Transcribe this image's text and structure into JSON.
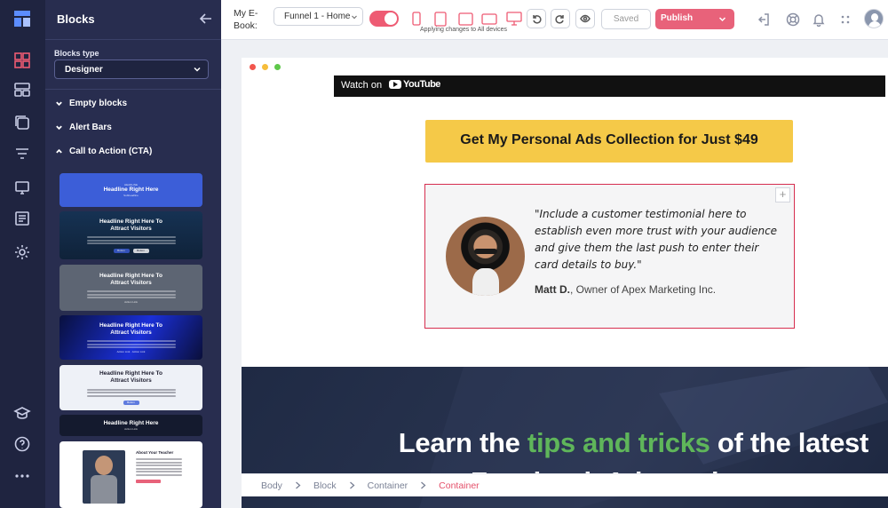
{
  "panel": {
    "title": "Blocks",
    "blocks_type_label": "Blocks type",
    "blocks_type_value": "Designer",
    "categories": [
      {
        "label": "Empty blocks",
        "state": "collapsed"
      },
      {
        "label": "Alert Bars",
        "state": "collapsed"
      },
      {
        "label": "Call to Action (CTA)",
        "state": "expanded"
      }
    ],
    "thumbnails": [
      {
        "kicker": "HEADLINE",
        "headline": "Headline Right Here",
        "sub": "Subheadline"
      },
      {
        "headline": "Headline Right Here To Attract Visitors",
        "buttons": [
          "Button",
          "Button"
        ]
      },
      {
        "headline": "Headline Right Here To Attract Visitors",
        "sub": "Action Link"
      },
      {
        "headline": "Headline Right Here To Attract Visitors",
        "sub": "Action Link · Action Link"
      },
      {
        "headline": "Headline Right Here To Attract Visitors",
        "buttons": [
          "Button"
        ]
      },
      {
        "headline": "Headline Right Here",
        "sub": "Action Link"
      },
      {
        "headline": "About Your Teacher"
      }
    ]
  },
  "toolbar": {
    "ebook_label": "My E-Book:",
    "funnel_select": "Funnel 1 - Home",
    "applying_text": "Applying changes to All devices",
    "saved_label": "Saved",
    "publish_label": "Publish",
    "accent": "#ee5b73"
  },
  "canvas": {
    "video": {
      "watch_label": "Watch on",
      "brand": "YouTube"
    },
    "cta_button": "Get My Personal Ads Collection for Just $49",
    "testimonial": {
      "quote": "\"Include a customer testimonial here to establish even more trust with your audience and give them the last push to enter their card details to buy.\"",
      "author_name": "Matt D.",
      "author_role": ", Owner of Apex Marketing Inc."
    },
    "learn": {
      "line1_prefix": "Learn the ",
      "line1_highlight": "tips and tricks",
      "line1_suffix": " of the latest",
      "line2": "Facebook Ad trends"
    },
    "breadcrumb": [
      "Body",
      "Block",
      "Container",
      "Container"
    ]
  }
}
